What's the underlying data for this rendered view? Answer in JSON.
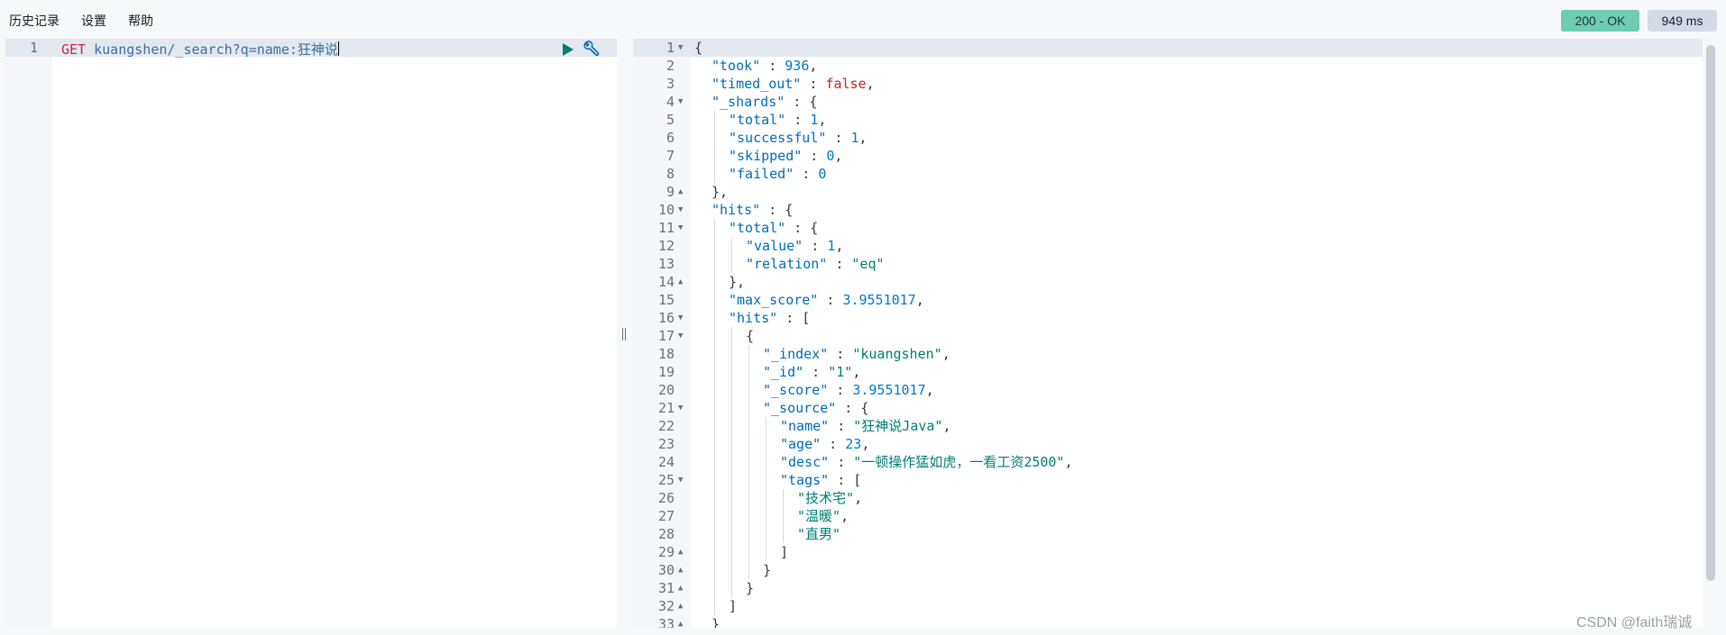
{
  "menu": {
    "history": "历史记录",
    "settings": "设置",
    "help": "帮助"
  },
  "status": {
    "code": "200 - OK",
    "time": "949 ms"
  },
  "request": {
    "line_number": "1",
    "method": "GET",
    "path": "kuangshen/_search?q=name:狂神说"
  },
  "response": {
    "lines": [
      {
        "n": "1",
        "fold": "open",
        "indent": 0,
        "parts": [
          [
            "p",
            "{"
          ]
        ]
      },
      {
        "n": "2",
        "fold": "",
        "indent": 1,
        "parts": [
          [
            "k",
            "\"took\""
          ],
          [
            "p",
            " : "
          ],
          [
            "n",
            "936"
          ],
          [
            "p",
            ","
          ]
        ]
      },
      {
        "n": "3",
        "fold": "",
        "indent": 1,
        "parts": [
          [
            "k",
            "\"timed_out\""
          ],
          [
            "p",
            " : "
          ],
          [
            "b",
            "false"
          ],
          [
            "p",
            ","
          ]
        ]
      },
      {
        "n": "4",
        "fold": "open",
        "indent": 1,
        "parts": [
          [
            "k",
            "\"_shards\""
          ],
          [
            "p",
            " : {"
          ]
        ]
      },
      {
        "n": "5",
        "fold": "",
        "indent": 2,
        "parts": [
          [
            "k",
            "\"total\""
          ],
          [
            "p",
            " : "
          ],
          [
            "n",
            "1"
          ],
          [
            "p",
            ","
          ]
        ]
      },
      {
        "n": "6",
        "fold": "",
        "indent": 2,
        "parts": [
          [
            "k",
            "\"successful\""
          ],
          [
            "p",
            " : "
          ],
          [
            "n",
            "1"
          ],
          [
            "p",
            ","
          ]
        ]
      },
      {
        "n": "7",
        "fold": "",
        "indent": 2,
        "parts": [
          [
            "k",
            "\"skipped\""
          ],
          [
            "p",
            " : "
          ],
          [
            "n",
            "0"
          ],
          [
            "p",
            ","
          ]
        ]
      },
      {
        "n": "8",
        "fold": "",
        "indent": 2,
        "parts": [
          [
            "k",
            "\"failed\""
          ],
          [
            "p",
            " : "
          ],
          [
            "n",
            "0"
          ]
        ]
      },
      {
        "n": "9",
        "fold": "close",
        "indent": 1,
        "parts": [
          [
            "p",
            "},"
          ]
        ]
      },
      {
        "n": "10",
        "fold": "open",
        "indent": 1,
        "parts": [
          [
            "k",
            "\"hits\""
          ],
          [
            "p",
            " : {"
          ]
        ]
      },
      {
        "n": "11",
        "fold": "open",
        "indent": 2,
        "parts": [
          [
            "k",
            "\"total\""
          ],
          [
            "p",
            " : {"
          ]
        ]
      },
      {
        "n": "12",
        "fold": "",
        "indent": 3,
        "parts": [
          [
            "k",
            "\"value\""
          ],
          [
            "p",
            " : "
          ],
          [
            "n",
            "1"
          ],
          [
            "p",
            ","
          ]
        ]
      },
      {
        "n": "13",
        "fold": "",
        "indent": 3,
        "parts": [
          [
            "k",
            "\"relation\""
          ],
          [
            "p",
            " : "
          ],
          [
            "s",
            "\"eq\""
          ]
        ]
      },
      {
        "n": "14",
        "fold": "close",
        "indent": 2,
        "parts": [
          [
            "p",
            "},"
          ]
        ]
      },
      {
        "n": "15",
        "fold": "",
        "indent": 2,
        "parts": [
          [
            "k",
            "\"max_score\""
          ],
          [
            "p",
            " : "
          ],
          [
            "n",
            "3.9551017"
          ],
          [
            "p",
            ","
          ]
        ]
      },
      {
        "n": "16",
        "fold": "open",
        "indent": 2,
        "parts": [
          [
            "k",
            "\"hits\""
          ],
          [
            "p",
            " : ["
          ]
        ]
      },
      {
        "n": "17",
        "fold": "open",
        "indent": 3,
        "parts": [
          [
            "p",
            "{"
          ]
        ]
      },
      {
        "n": "18",
        "fold": "",
        "indent": 4,
        "parts": [
          [
            "k",
            "\"_index\""
          ],
          [
            "p",
            " : "
          ],
          [
            "s",
            "\"kuangshen\""
          ],
          [
            "p",
            ","
          ]
        ]
      },
      {
        "n": "19",
        "fold": "",
        "indent": 4,
        "parts": [
          [
            "k",
            "\"_id\""
          ],
          [
            "p",
            " : "
          ],
          [
            "s",
            "\"1\""
          ],
          [
            "p",
            ","
          ]
        ]
      },
      {
        "n": "20",
        "fold": "",
        "indent": 4,
        "parts": [
          [
            "k",
            "\"_score\""
          ],
          [
            "p",
            " : "
          ],
          [
            "n",
            "3.9551017"
          ],
          [
            "p",
            ","
          ]
        ]
      },
      {
        "n": "21",
        "fold": "open",
        "indent": 4,
        "parts": [
          [
            "k",
            "\"_source\""
          ],
          [
            "p",
            " : {"
          ]
        ]
      },
      {
        "n": "22",
        "fold": "",
        "indent": 5,
        "parts": [
          [
            "k",
            "\"name\""
          ],
          [
            "p",
            " : "
          ],
          [
            "s",
            "\"狂神说Java\""
          ],
          [
            "p",
            ","
          ]
        ]
      },
      {
        "n": "23",
        "fold": "",
        "indent": 5,
        "parts": [
          [
            "k",
            "\"age\""
          ],
          [
            "p",
            " : "
          ],
          [
            "n",
            "23"
          ],
          [
            "p",
            ","
          ]
        ]
      },
      {
        "n": "24",
        "fold": "",
        "indent": 5,
        "parts": [
          [
            "k",
            "\"desc\""
          ],
          [
            "p",
            " : "
          ],
          [
            "s",
            "\"一顿操作猛如虎，一看工资2500\""
          ],
          [
            "p",
            ","
          ]
        ]
      },
      {
        "n": "25",
        "fold": "open",
        "indent": 5,
        "parts": [
          [
            "k",
            "\"tags\""
          ],
          [
            "p",
            " : ["
          ]
        ]
      },
      {
        "n": "26",
        "fold": "",
        "indent": 6,
        "parts": [
          [
            "s",
            "\"技术宅\""
          ],
          [
            "p",
            ","
          ]
        ]
      },
      {
        "n": "27",
        "fold": "",
        "indent": 6,
        "parts": [
          [
            "s",
            "\"温暖\""
          ],
          [
            "p",
            ","
          ]
        ]
      },
      {
        "n": "28",
        "fold": "",
        "indent": 6,
        "parts": [
          [
            "s",
            "\"直男\""
          ]
        ]
      },
      {
        "n": "29",
        "fold": "close",
        "indent": 5,
        "parts": [
          [
            "p",
            "]"
          ]
        ]
      },
      {
        "n": "30",
        "fold": "close",
        "indent": 4,
        "parts": [
          [
            "p",
            "}"
          ]
        ]
      },
      {
        "n": "31",
        "fold": "close",
        "indent": 3,
        "parts": [
          [
            "p",
            "}"
          ]
        ]
      },
      {
        "n": "32",
        "fold": "close",
        "indent": 2,
        "parts": [
          [
            "p",
            "]"
          ]
        ]
      },
      {
        "n": "33",
        "fold": "close",
        "indent": 1,
        "parts": [
          [
            "p",
            "}"
          ]
        ]
      }
    ]
  },
  "icons": {
    "run": "play-icon",
    "wrench": "wrench-icon",
    "fold_open": "fold-open-icon",
    "fold_close": "fold-close-icon"
  },
  "colors": {
    "status_ok": "#6dccb1",
    "key": "#006bb8",
    "string": "#017d73",
    "boolean": "#bd271e",
    "number": "#0077cc"
  },
  "watermark": "CSDN @faith瑞诚"
}
